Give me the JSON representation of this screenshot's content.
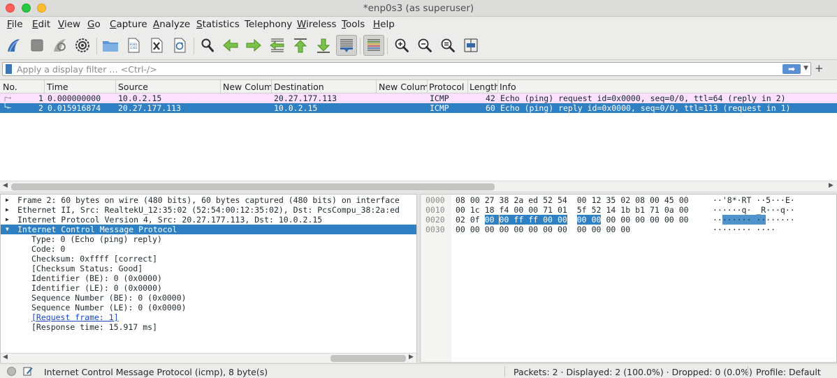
{
  "window": {
    "title": "*enp0s3 (as superuser)"
  },
  "colors": {
    "close": "#ff5f57",
    "minimize": "#28c940",
    "maximize": "#ffbd2e",
    "selection": "#2f80c2",
    "icmp_row": "#fce0ff"
  },
  "menu": [
    {
      "label": "File",
      "u": "F",
      "rest": "ile"
    },
    {
      "label": "Edit",
      "u": "E",
      "rest": "dit"
    },
    {
      "label": "View",
      "u": "V",
      "rest": "iew"
    },
    {
      "label": "Go",
      "u": "G",
      "rest": "o"
    },
    {
      "label": "Capture",
      "u": "C",
      "rest": "apture"
    },
    {
      "label": "Analyze",
      "u": "A",
      "rest": "nalyze"
    },
    {
      "label": "Statistics",
      "u": "S",
      "rest": "tatistics"
    },
    {
      "label": "Telephony",
      "u": "",
      "rest": "Telephony"
    },
    {
      "label": "Wireless",
      "u": "W",
      "rest": "ireless"
    },
    {
      "label": "Tools",
      "u": "T",
      "rest": "ools"
    },
    {
      "label": "Help",
      "u": "H",
      "rest": "elp"
    }
  ],
  "toolbar": {
    "icons": [
      "start-capture-icon",
      "stop-capture-icon",
      "restart-capture-icon",
      "capture-options-icon",
      "open-file-icon",
      "save-file-icon",
      "close-file-icon",
      "reload-file-icon",
      "find-packet-icon",
      "go-back-icon",
      "go-forward-icon",
      "go-to-packet-icon",
      "first-packet-icon",
      "last-packet-icon",
      "autoscroll-icon",
      "colorize-icon",
      "zoom-in-icon",
      "zoom-out-icon",
      "normal-size-icon",
      "resize-columns-icon"
    ]
  },
  "filter": {
    "placeholder": "Apply a display filter … <Ctrl-/>",
    "value": "",
    "apply_label": "➡",
    "dropdown": "▼",
    "add": "+"
  },
  "packet_list": {
    "columns": [
      "No.",
      "Time",
      "Source",
      "New Colum",
      "Destination",
      "New Colum",
      "Protocol",
      "Length",
      "Info"
    ],
    "rows": [
      {
        "no": "1",
        "time": "0.000000000",
        "source": "10.0.2.15",
        "col4": "",
        "destination": "20.27.177.113",
        "col6": "",
        "protocol": "ICMP",
        "length": "42",
        "info": "Echo (ping) request  id=0x0000, seq=0/0, ttl=64 (reply in 2)"
      },
      {
        "no": "2",
        "time": "0.015916874",
        "source": "20.27.177.113",
        "col4": "",
        "destination": "10.0.2.15",
        "col6": "",
        "protocol": "ICMP",
        "length": "60",
        "info": "Echo (ping) reply    id=0x0000, seq=0/0, ttl=113 (request in 1)"
      }
    ]
  },
  "details": {
    "lines": [
      {
        "text": "Frame 2: 60 bytes on wire (480 bits), 60 bytes captured (480 bits) on interface",
        "indent": 0,
        "expander": "▶",
        "selected": false,
        "link": false
      },
      {
        "text": "Ethernet II, Src: RealtekU_12:35:02 (52:54:00:12:35:02), Dst: PcsCompu_38:2a:ed",
        "indent": 0,
        "expander": "▶",
        "selected": false,
        "link": false
      },
      {
        "text": "Internet Protocol Version 4, Src: 20.27.177.113, Dst: 10.0.2.15",
        "indent": 0,
        "expander": "▶",
        "selected": false,
        "link": false
      },
      {
        "text": "Internet Control Message Protocol",
        "indent": 0,
        "expander": "▼",
        "selected": true,
        "link": false
      },
      {
        "text": "Type: 0 (Echo (ping) reply)",
        "indent": 1,
        "expander": "",
        "selected": false,
        "link": false
      },
      {
        "text": "Code: 0",
        "indent": 1,
        "expander": "",
        "selected": false,
        "link": false
      },
      {
        "text": "Checksum: 0xffff [correct]",
        "indent": 1,
        "expander": "",
        "selected": false,
        "link": false
      },
      {
        "text": "[Checksum Status: Good]",
        "indent": 1,
        "expander": "",
        "selected": false,
        "link": false
      },
      {
        "text": "Identifier (BE): 0 (0x0000)",
        "indent": 1,
        "expander": "",
        "selected": false,
        "link": false
      },
      {
        "text": "Identifier (LE): 0 (0x0000)",
        "indent": 1,
        "expander": "",
        "selected": false,
        "link": false
      },
      {
        "text": "Sequence Number (BE): 0 (0x0000)",
        "indent": 1,
        "expander": "",
        "selected": false,
        "link": false
      },
      {
        "text": "Sequence Number (LE): 0 (0x0000)",
        "indent": 1,
        "expander": "",
        "selected": false,
        "link": false
      },
      {
        "text": "[Request frame: 1]",
        "indent": 1,
        "expander": "",
        "selected": false,
        "link": true
      },
      {
        "text": "[Response time: 15.917 ms]",
        "indent": 1,
        "expander": "",
        "selected": false,
        "link": false
      }
    ]
  },
  "hex": {
    "lines": [
      {
        "offset": "0000",
        "bytes": [
          "08",
          "00",
          "27",
          "38",
          "2a",
          "ed",
          "52",
          "54",
          "00",
          "12",
          "35",
          "02",
          "08",
          "00",
          "45",
          "00"
        ],
        "ascii": "··'8*·RT ··5···E·",
        "hl": []
      },
      {
        "offset": "0010",
        "bytes": [
          "00",
          "1c",
          "18",
          "f4",
          "00",
          "00",
          "71",
          "01",
          "5f",
          "52",
          "14",
          "1b",
          "b1",
          "71",
          "0a",
          "00"
        ],
        "ascii": "······q· _R···q··",
        "hl": []
      },
      {
        "offset": "0020",
        "bytes": [
          "02",
          "0f",
          "00",
          "00",
          "ff",
          "ff",
          "00",
          "00",
          "00",
          "00",
          "00",
          "00",
          "00",
          "00",
          "00",
          "00"
        ],
        "ascii": "········ ········",
        "hl": [
          2,
          3,
          4,
          5,
          6,
          7,
          8,
          9
        ]
      },
      {
        "offset": "0030",
        "bytes": [
          "00",
          "00",
          "00",
          "00",
          "00",
          "00",
          "00",
          "00",
          "00",
          "00",
          "00",
          "00"
        ],
        "ascii": "········ ····",
        "hl": []
      }
    ]
  },
  "status": {
    "field": "Internet Control Message Protocol (icmp), 8 byte(s)",
    "packets": "Packets: 2 · Displayed: 2 (100.0%) · Dropped: 0 (0.0%)",
    "profile": "Profile: Default"
  }
}
